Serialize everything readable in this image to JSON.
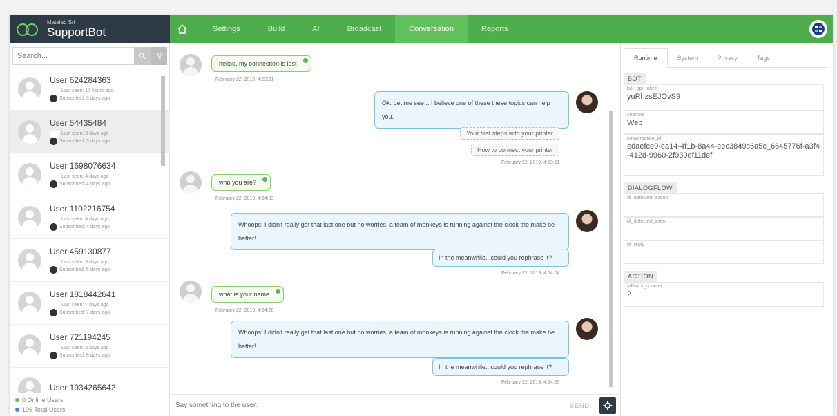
{
  "brand": {
    "small": "Matelab Srl",
    "name": "SupportBot"
  },
  "nav": {
    "home_icon": "home-icon",
    "items": [
      "Settings",
      "Build",
      "AI",
      "Broadcast",
      "Conversation",
      "Reports"
    ],
    "active": "Conversation"
  },
  "search": {
    "placeholder": "Search..."
  },
  "users": [
    {
      "name": "User 624284363",
      "last_seen": "Last seen: 17 hours ago",
      "subscribed": "Subscribed: 3 days ago"
    },
    {
      "name": "User 54435484",
      "last_seen": "Last seen: 3 days ago",
      "subscribed": "Subscribed: 3 days ago"
    },
    {
      "name": "User 1698076634",
      "last_seen": "Last seen: 4 days ago",
      "subscribed": "Subscribed: 4 days ago"
    },
    {
      "name": "User 1102216754",
      "last_seen": "Last seen: 4 days ago",
      "subscribed": "Subscribed: 4 days ago"
    },
    {
      "name": "User 459130877",
      "last_seen": "Last seen: 5 days ago",
      "subscribed": "Subscribed: 5 days ago"
    },
    {
      "name": "User 1818442641",
      "last_seen": "Last seen: 7 days ago",
      "subscribed": "Subscribed: 7 days ago"
    },
    {
      "name": "User 721194245",
      "last_seen": "Last seen: 8 days ago",
      "subscribed": "Subscribed: 8 days ago"
    },
    {
      "name": "User 1934265642",
      "last_seen": "",
      "subscribed": ""
    }
  ],
  "stats": {
    "online": "0 Online Users",
    "total": "106 Total Users"
  },
  "messages": {
    "m1": {
      "text": "helloo, my connection is lost",
      "time": "February 22, 2019, 4:53:51"
    },
    "m2": {
      "text": "Ok. Let me see... I believe one of these these topics can help you.",
      "time": "February 22, 2019, 4:53:51"
    },
    "chip1": "Your first steps with your printer",
    "chip2": "How to connect your printer",
    "m3": {
      "text": "who you are?",
      "time": "February 22, 2019, 4:54:03"
    },
    "m4": {
      "text": "Whoops! I didn't really get that last one but no worries, a team of monkeys is running against the clock the make be better!"
    },
    "m5": {
      "text": "In the meanwhile...could you rephrase it?",
      "time": "February 22, 2019, 4:54:04"
    },
    "m6": {
      "text": "what is your name",
      "time": "February 22, 2019, 4:54:20"
    },
    "m7": {
      "text": "Whoops! I didn't really get that last one but no worries, a team of monkeys is running against the clock the make be better!"
    },
    "m8": {
      "text": "In the meanwhile...could you rephrase it?",
      "time": "February 22, 2019, 4:54:20"
    }
  },
  "composer": {
    "placeholder": "Say something to the user...",
    "send_label": "SEND"
  },
  "right": {
    "tabs": [
      "Runtime",
      "System",
      "Privacy",
      "Tags"
    ],
    "active_tab": "Runtime",
    "bot": {
      "title": "BOT",
      "fields": [
        {
          "label": "bot_api_token",
          "value": "yuRhzsEJOvS9"
        },
        {
          "label": "channel",
          "value": "Web"
        },
        {
          "label": "conversation_id",
          "value": "edaefce9-ea14-4f1b-8a44-eec3849c6a5c_6645776f-a3f4-412d-9960-2f939df11def"
        }
      ]
    },
    "dialogflow": {
      "title": "DIALOGFLOW",
      "fields": [
        {
          "label": "df_detected_action",
          "value": ""
        },
        {
          "label": "df_detected_intent",
          "value": ""
        },
        {
          "label": "df_reply",
          "value": ""
        }
      ]
    },
    "action": {
      "title": "ACTION",
      "fields": [
        {
          "label": "fallback_counter",
          "value": "2"
        }
      ]
    }
  },
  "colors": {
    "brand_dark": "#2f3b44",
    "nav_green": "#4fae4c",
    "nav_active": "#62c05e",
    "user_bubble_border": "#8ccc6e",
    "agent_bubble_border": "#7cc3dd",
    "online_dot": "#5fb558",
    "total_dot": "#2e8fd6"
  }
}
